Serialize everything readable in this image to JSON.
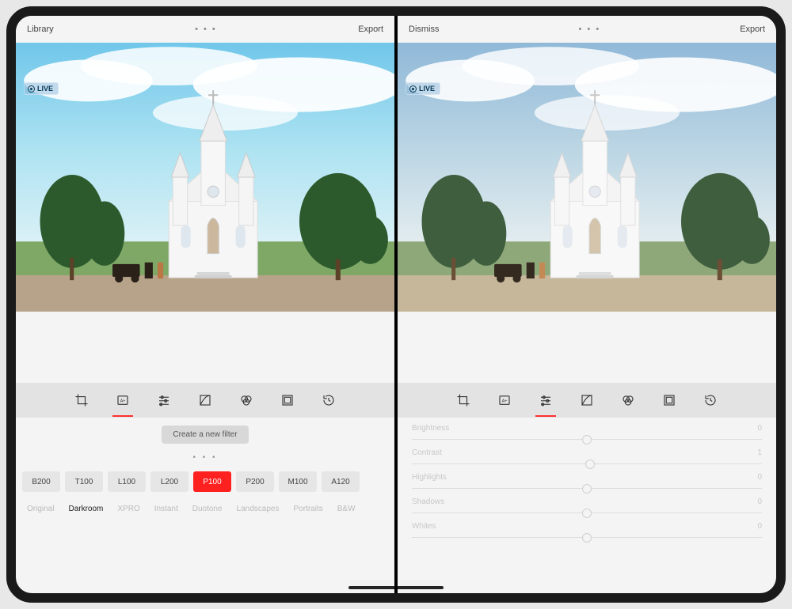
{
  "left": {
    "topbar": {
      "left": "Library",
      "mid": "• • •",
      "right": "Export"
    },
    "live_label": "LIVE",
    "create_filter_label": "Create a new filter",
    "dots": "• • •",
    "active_tool_index": 1,
    "filters": [
      {
        "label": "B200",
        "active": false
      },
      {
        "label": "T100",
        "active": false
      },
      {
        "label": "L100",
        "active": false
      },
      {
        "label": "L200",
        "active": false
      },
      {
        "label": "P100",
        "active": true
      },
      {
        "label": "P200",
        "active": false
      },
      {
        "label": "M100",
        "active": false
      },
      {
        "label": "A120",
        "active": false
      }
    ],
    "categories": [
      {
        "label": "Original",
        "active": false
      },
      {
        "label": "Darkroom",
        "active": true
      },
      {
        "label": "XPRO",
        "active": false
      },
      {
        "label": "Instant",
        "active": false
      },
      {
        "label": "Duotone",
        "active": false
      },
      {
        "label": "Landscapes",
        "active": false
      },
      {
        "label": "Portraits",
        "active": false
      },
      {
        "label": "B&W",
        "active": false
      }
    ]
  },
  "right": {
    "topbar": {
      "left": "Dismiss",
      "mid": "• • •",
      "right": "Export"
    },
    "live_label": "LIVE",
    "active_tool_index": 2,
    "sliders": [
      {
        "name": "Brightness",
        "value": "0",
        "knobPct": 50
      },
      {
        "name": "Contrast",
        "value": "1",
        "knobPct": 51
      },
      {
        "name": "Highlights",
        "value": "0",
        "knobPct": 50
      },
      {
        "name": "Shadows",
        "value": "0",
        "knobPct": 50
      },
      {
        "name": "Whites",
        "value": "0",
        "knobPct": 50
      }
    ]
  },
  "tool_icons": [
    "crop",
    "filters",
    "adjust",
    "curves",
    "color",
    "frame",
    "history"
  ],
  "colors": {
    "accent": "#ff2a2a"
  }
}
